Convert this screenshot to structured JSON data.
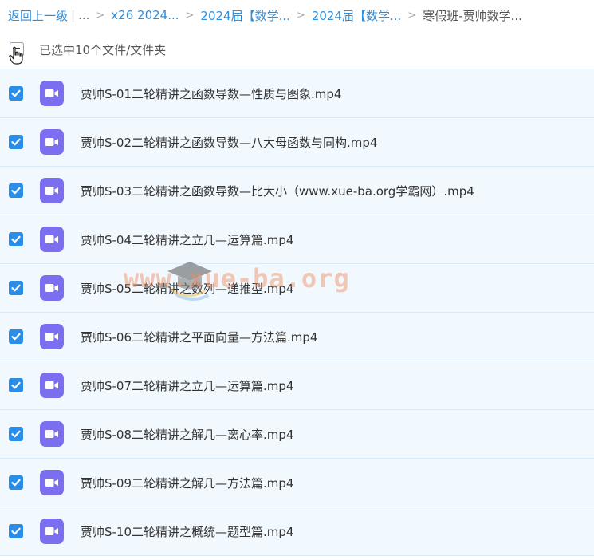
{
  "breadcrumb": {
    "back": "返回上一级",
    "bar": "|",
    "ellipsis": "...",
    "items": [
      "x26 2024...",
      "2024届【数学...",
      "2024届【数学..."
    ],
    "current": "寒假班-贾帅数学..."
  },
  "selection": {
    "text": "已选中10个文件/文件夹"
  },
  "files": [
    {
      "name": "贾帅S-01二轮精讲之函数导数—性质与图象.mp4"
    },
    {
      "name": "贾帅S-02二轮精讲之函数导数—八大母函数与同构.mp4"
    },
    {
      "name": "贾帅S-03二轮精讲之函数导数—比大小（www.xue-ba.org学霸网）.mp4"
    },
    {
      "name": "贾帅S-04二轮精讲之立几—运算篇.mp4"
    },
    {
      "name": "贾帅S-05二轮精讲之数列—递推型.mp4"
    },
    {
      "name": "贾帅S-06二轮精讲之平面向量—方法篇.mp4"
    },
    {
      "name": "贾帅S-07二轮精讲之立几—运算篇.mp4"
    },
    {
      "name": "贾帅S-08二轮精讲之解几—离心率.mp4"
    },
    {
      "name": "贾帅S-09二轮精讲之解几—方法篇.mp4"
    },
    {
      "name": "贾帅S-10二轮精讲之概统—题型篇.mp4"
    }
  ],
  "watermark": {
    "text": "www.xue-ba.org"
  },
  "colors": {
    "accent": "#2a8ee8",
    "video_icon": "#7b6ff0",
    "row_bg": "#f1f8fe"
  }
}
